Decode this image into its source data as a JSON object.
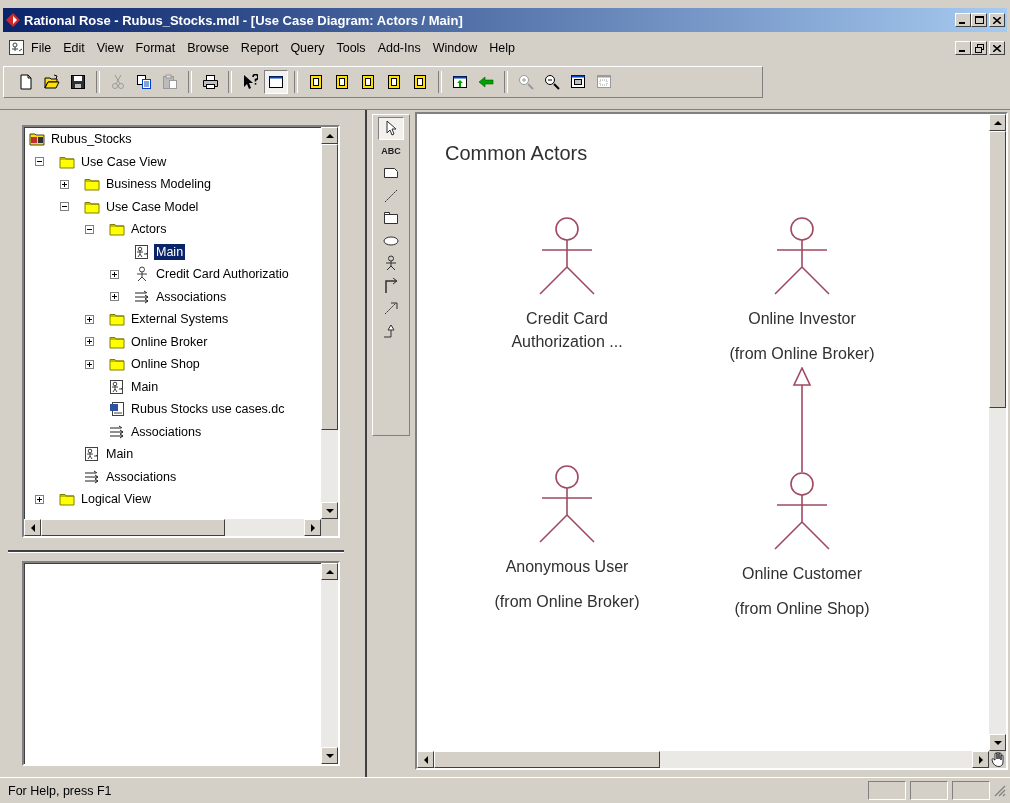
{
  "window": {
    "title": "Rational Rose - Rubus_Stocks.mdl - [Use Case Diagram: Actors / Main]"
  },
  "menu": [
    "File",
    "Edit",
    "View",
    "Format",
    "Browse",
    "Report",
    "Query",
    "Tools",
    "Add-Ins",
    "Window",
    "Help"
  ],
  "toolbar": [
    {
      "kind": "new",
      "disabled": false,
      "pressed": false
    },
    {
      "kind": "open",
      "disabled": false,
      "pressed": false
    },
    {
      "kind": "save",
      "disabled": false,
      "pressed": false
    },
    {
      "kind": "separator"
    },
    {
      "kind": "cut",
      "disabled": true,
      "pressed": false
    },
    {
      "kind": "copy",
      "disabled": false,
      "pressed": false
    },
    {
      "kind": "paste",
      "disabled": true,
      "pressed": false
    },
    {
      "kind": "separator"
    },
    {
      "kind": "print",
      "disabled": false,
      "pressed": false
    },
    {
      "kind": "separator"
    },
    {
      "kind": "context-help",
      "disabled": false,
      "pressed": false
    },
    {
      "kind": "browse-window",
      "disabled": false,
      "pressed": true
    },
    {
      "kind": "separator"
    },
    {
      "kind": "diagram",
      "disabled": false,
      "pressed": false
    },
    {
      "kind": "diagram",
      "disabled": false,
      "pressed": false
    },
    {
      "kind": "diagram",
      "disabled": false,
      "pressed": false
    },
    {
      "kind": "diagram",
      "disabled": false,
      "pressed": false
    },
    {
      "kind": "diagram",
      "disabled": false,
      "pressed": false
    },
    {
      "kind": "separator"
    },
    {
      "kind": "parent-diagram",
      "disabled": false,
      "pressed": false
    },
    {
      "kind": "previous-diagram",
      "disabled": false,
      "pressed": false
    },
    {
      "kind": "separator"
    },
    {
      "kind": "zoom-in",
      "disabled": true,
      "pressed": false
    },
    {
      "kind": "zoom-out",
      "disabled": false,
      "pressed": false
    },
    {
      "kind": "fit-window",
      "disabled": false,
      "pressed": false
    },
    {
      "kind": "undo-fit",
      "disabled": true,
      "pressed": false
    }
  ],
  "browser": {
    "tree": [
      {
        "kind": "model",
        "label": "Rubus_Stocks",
        "selected": false,
        "children": [
          {
            "kind": "folder",
            "label": "Use Case View",
            "selected": false,
            "expanded": true,
            "children": [
              {
                "kind": "folder",
                "label": "Business Modeling",
                "selected": false,
                "expanded": false
              },
              {
                "kind": "folder",
                "label": "Use Case Model",
                "selected": false,
                "expanded": true,
                "children": [
                  {
                    "kind": "folder",
                    "label": "Actors",
                    "selected": false,
                    "expanded": true,
                    "children": [
                      {
                        "kind": "diagram",
                        "label": "Main",
                        "selected": true
                      },
                      {
                        "kind": "actor",
                        "label": "Credit Card Authorizatio",
                        "selected": false,
                        "expanded": false
                      },
                      {
                        "kind": "associations",
                        "label": "Associations",
                        "selected": false,
                        "expanded": false
                      }
                    ]
                  },
                  {
                    "kind": "folder",
                    "label": "External Systems",
                    "selected": false,
                    "expanded": false
                  },
                  {
                    "kind": "folder",
                    "label": "Online Broker",
                    "selected": false,
                    "expanded": false
                  },
                  {
                    "kind": "folder",
                    "label": "Online Shop",
                    "selected": false,
                    "expanded": false
                  },
                  {
                    "kind": "diagram",
                    "label": "Main",
                    "selected": false
                  },
                  {
                    "kind": "document",
                    "label": "Rubus Stocks use cases.dc",
                    "selected": false
                  },
                  {
                    "kind": "associations",
                    "label": "Associations",
                    "selected": false
                  }
                ]
              },
              {
                "kind": "diagram",
                "label": "Main",
                "selected": false
              },
              {
                "kind": "associations",
                "label": "Associations",
                "selected": false
              }
            ]
          },
          {
            "kind": "folder",
            "label": "Logical View",
            "selected": false,
            "expanded": false
          }
        ]
      }
    ]
  },
  "toolbox": [
    {
      "kind": "pointer",
      "selected": true
    },
    {
      "kind": "text",
      "label": "ABC",
      "selected": false
    },
    {
      "kind": "note",
      "selected": false
    },
    {
      "kind": "anchor",
      "selected": false
    },
    {
      "kind": "package",
      "selected": false
    },
    {
      "kind": "use-case",
      "selected": false
    },
    {
      "kind": "actor",
      "selected": false
    },
    {
      "kind": "association",
      "selected": false
    },
    {
      "kind": "dependency",
      "selected": false
    },
    {
      "kind": "generalization",
      "selected": false
    }
  ],
  "diagram": {
    "title": "Common Actors",
    "actors": [
      {
        "name": "Credit Card Authorization ..."
      },
      {
        "name": "Online Investor",
        "package": "(from Online Broker)"
      },
      {
        "name": "Anonymous User",
        "package": "(from Online Broker)"
      },
      {
        "name": "Online Customer",
        "package": "(from Online Shop)"
      }
    ],
    "relations": [
      {
        "kind": "generalization"
      }
    ]
  },
  "status_bar": {
    "text": "For Help, press F1"
  }
}
